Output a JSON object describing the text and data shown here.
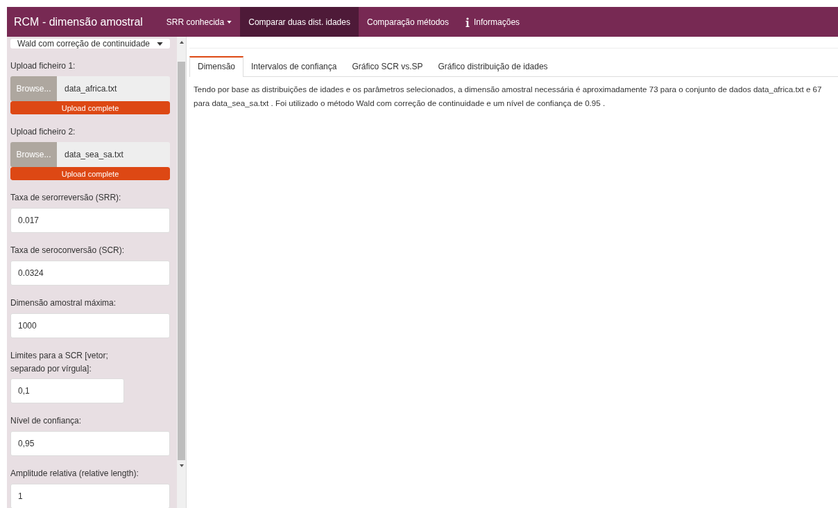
{
  "navbar": {
    "brand": "RCM - dimensão amostral",
    "items": [
      {
        "label": "SRR conhecida",
        "kind": "dropdown",
        "selected": false
      },
      {
        "label": "Comparar duas dist. idades",
        "kind": "plain",
        "selected": true
      },
      {
        "label": "Comparação métodos",
        "kind": "plain",
        "selected": false
      },
      {
        "label": "Informações",
        "kind": "info",
        "selected": false
      }
    ]
  },
  "sidebar": {
    "fields": [
      {
        "kind": "select",
        "value": "Wald com correção de continuidade"
      },
      {
        "kind": "file",
        "label": "Upload ficheiro 1:",
        "button": "Browse...",
        "value": "data_africa.txt",
        "progress": "Upload complete",
        "level": 1
      },
      {
        "kind": "file",
        "label": "Upload ficheiro 2:",
        "button": "Browse...",
        "value": "data_sea_sa.txt",
        "progress": "Upload complete",
        "level": 1
      },
      {
        "kind": "text",
        "label": "Taxa de serorreversão (SRR):",
        "value": "0.017"
      },
      {
        "kind": "text",
        "label": "Taxa de seroconversão (SCR):",
        "value": "0.0324"
      },
      {
        "kind": "text",
        "label": "Dimensão amostral máxima:",
        "value": "1000"
      },
      {
        "kind": "narrow",
        "label": "Limites para a SCR [vetor; separado por vírgula]:",
        "value": "0,1"
      },
      {
        "kind": "text",
        "label": "Nível de confiança:",
        "value": "0,95"
      },
      {
        "kind": "text",
        "label": "Amplitude relativa (relative length):",
        "value": "1"
      }
    ]
  },
  "tabs": [
    {
      "label": "Dimensão",
      "selected": true
    },
    {
      "label": "Intervalos de confiança",
      "selected": false
    },
    {
      "label": "Gráfico SCR vs.SP",
      "selected": false
    },
    {
      "label": "Gráfico distribuição de idades",
      "selected": false
    }
  ],
  "result": "Tendo por base as distribuições de idades e os parâmetros selecionados, a dimensão amostral necessária é aproximadamente 73 para o conjunto de dados data_africa.txt e 67 para data_sea_sa.txt . Foi utilizado o método Wald com correção de continuidade e um nível de confiança de 0.95 ."
}
